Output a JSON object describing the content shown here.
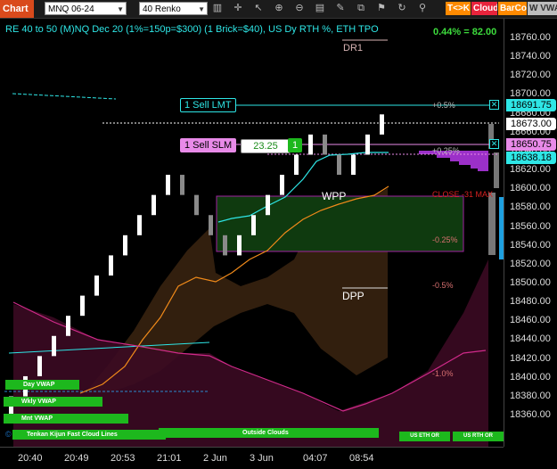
{
  "toolbar": {
    "title": "Chart",
    "instrument": "MNQ 06-24",
    "bar_type": "40 Renko",
    "icons": [
      "chart-style-icon",
      "crosshair-icon",
      "pointer-icon",
      "zoom-in-icon",
      "zoom-out-icon",
      "chart-properties-icon",
      "draw-icon",
      "window-linking-icon",
      "strategy-icon",
      "cycle-icon",
      "attach-icon"
    ],
    "badge_tk": "T<>K",
    "badge_cloud": "Cloud",
    "badge_barcol": "BarCol",
    "badge_vwap": "W VWA",
    "colors": {
      "tk": "#ff8a00",
      "cloud": "#e8243c",
      "barcol": "#ff8a00",
      "vwap": "#bdbdbd"
    }
  },
  "header": {
    "info": "RE 40 to 50 (M)NQ Dec 20 (1%=150p=$300) (1 Brick=$40), US Dy RTH %, ETH TPO",
    "percent": "0.44% = 82.00"
  },
  "price_axis": {
    "ticks": [
      "18760.00",
      "18740.00",
      "18720.00",
      "18700.00",
      "18680.00",
      "18660.00",
      "18640.00",
      "18620.00",
      "18600.00",
      "18580.00",
      "18560.00",
      "18540.00",
      "18520.00",
      "18500.00",
      "18480.00",
      "18460.00",
      "18440.00",
      "18420.00",
      "18400.00",
      "18380.00",
      "18360.00"
    ],
    "labels": [
      {
        "text": "18691.75",
        "color": "#2ee6e6"
      },
      {
        "text": "18673.00",
        "color": "#ffffff"
      },
      {
        "text": "18650.75",
        "color": "#e88ae8"
      },
      {
        "text": "18638.18",
        "color": "#2ee6e6"
      }
    ]
  },
  "time_axis": {
    "ticks": [
      "20:40",
      "20:49",
      "20:53",
      "21:01",
      "2 Jun",
      "3 Jun",
      "04:07",
      "08:54"
    ]
  },
  "orders": {
    "sell_lmt": "1 Sell LMT",
    "sell_slm": "1 Sell SLM",
    "slm_price": "23.25",
    "slm_qty": "1"
  },
  "levels": {
    "dr1": "DR1",
    "wpp": "WPP",
    "dpp": "DPP",
    "pct_plus_05": "+0.5%",
    "pct_plus_025": "+0.25%",
    "pct_minus_025": "-0.25%",
    "pct_minus_05": "-0.5%",
    "pct_minus_10": "-1.0%",
    "close": "CLOSE -31 MAX"
  },
  "buttons": {
    "day_vwap": "Day VWAP",
    "wkly_vwap": "Wkly VWAP",
    "mnt_vwap": "Mnt VWAP",
    "tenkan": "Tenkan Kijun Fast Cloud Lines",
    "outside_clouds": "Outside Clouds",
    "us_eth": "US ETH OR",
    "us_rth": "US RTH OR"
  },
  "copyright": "© 20",
  "chart_data": {
    "type": "renko",
    "brick_size": 40,
    "ylim": [
      18350,
      18775
    ],
    "bricks": [
      {
        "close": 18400,
        "dir": "up"
      },
      {
        "close": 18420,
        "dir": "up"
      },
      {
        "close": 18440,
        "dir": "up"
      },
      {
        "close": 18460,
        "dir": "up"
      },
      {
        "close": 18480,
        "dir": "up"
      },
      {
        "close": 18500,
        "dir": "up"
      },
      {
        "close": 18520,
        "dir": "up"
      },
      {
        "close": 18540,
        "dir": "up"
      },
      {
        "close": 18560,
        "dir": "up"
      },
      {
        "close": 18580,
        "dir": "up"
      },
      {
        "close": 18600,
        "dir": "up"
      },
      {
        "close": 18620,
        "dir": "up"
      },
      {
        "close": 18600,
        "dir": "down"
      },
      {
        "close": 18580,
        "dir": "down"
      },
      {
        "close": 18560,
        "dir": "down"
      },
      {
        "close": 18540,
        "dir": "down"
      },
      {
        "close": 18560,
        "dir": "up"
      },
      {
        "close": 18580,
        "dir": "up"
      },
      {
        "close": 18600,
        "dir": "up"
      },
      {
        "close": 18620,
        "dir": "up"
      },
      {
        "close": 18640,
        "dir": "up"
      },
      {
        "close": 18660,
        "dir": "up"
      },
      {
        "close": 18640,
        "dir": "down"
      },
      {
        "close": 18620,
        "dir": "down"
      },
      {
        "close": 18640,
        "dir": "up"
      },
      {
        "close": 18660,
        "dir": "up"
      },
      {
        "close": 18680,
        "dir": "up"
      }
    ]
  }
}
